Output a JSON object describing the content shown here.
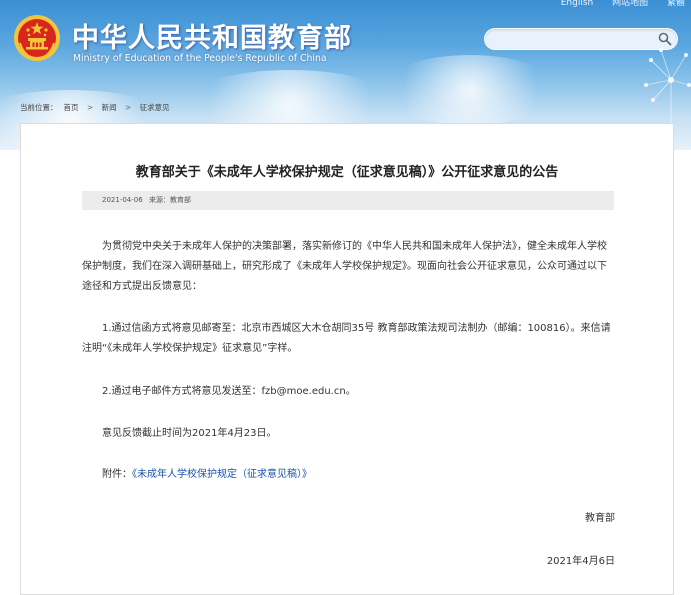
{
  "header": {
    "top_links": [
      "English",
      "网站地图",
      "繁體"
    ],
    "site_title": "中华人民共和国教育部",
    "site_subtitle": "Ministry of Education of the People's Republic of China",
    "search_placeholder": ""
  },
  "breadcrumb": {
    "prefix": "当前位置：",
    "items": [
      "首页",
      "新闻",
      "征求意见"
    ],
    "separator": ">"
  },
  "article": {
    "title": "教育部关于《未成年人学校保护规定（征求意见稿）》公开征求意见的公告",
    "meta_date": "2021-04-06",
    "meta_source": "来源：教育部",
    "paragraphs": [
      "为贯彻党中央关于未成年人保护的决策部署，落实新修订的《中华人民共和国未成年人保护法》，健全未成年人学校保护制度，我们在深入调研基础上，研究形成了《未成年人学校保护规定》。现面向社会公开征求意见，公众可通过以下途径和方式提出反馈意见：",
      "1.通过信函方式将意见邮寄至：北京市西城区大木仓胡同35号 教育部政策法规司法制办（邮编：100816）。来信请注明“《未成年人学校保护规定》征求意见”字样。",
      "2.通过电子邮件方式将意见发送至：fzb@moe.edu.cn。",
      "意见反馈截止时间为2021年4月23日。"
    ],
    "attachment_label": "附件：",
    "attachment_link": "《未成年人学校保护规定（征求意见稿）》",
    "signature_org": "教育部",
    "signature_date": "2021年4月6日"
  },
  "colors": {
    "header_blue": "#3a8fd3",
    "link_blue": "#1a53a8",
    "meta_bar_gray": "#ececec",
    "emblem_red": "#d8261c",
    "emblem_gold": "#f3c53a"
  }
}
